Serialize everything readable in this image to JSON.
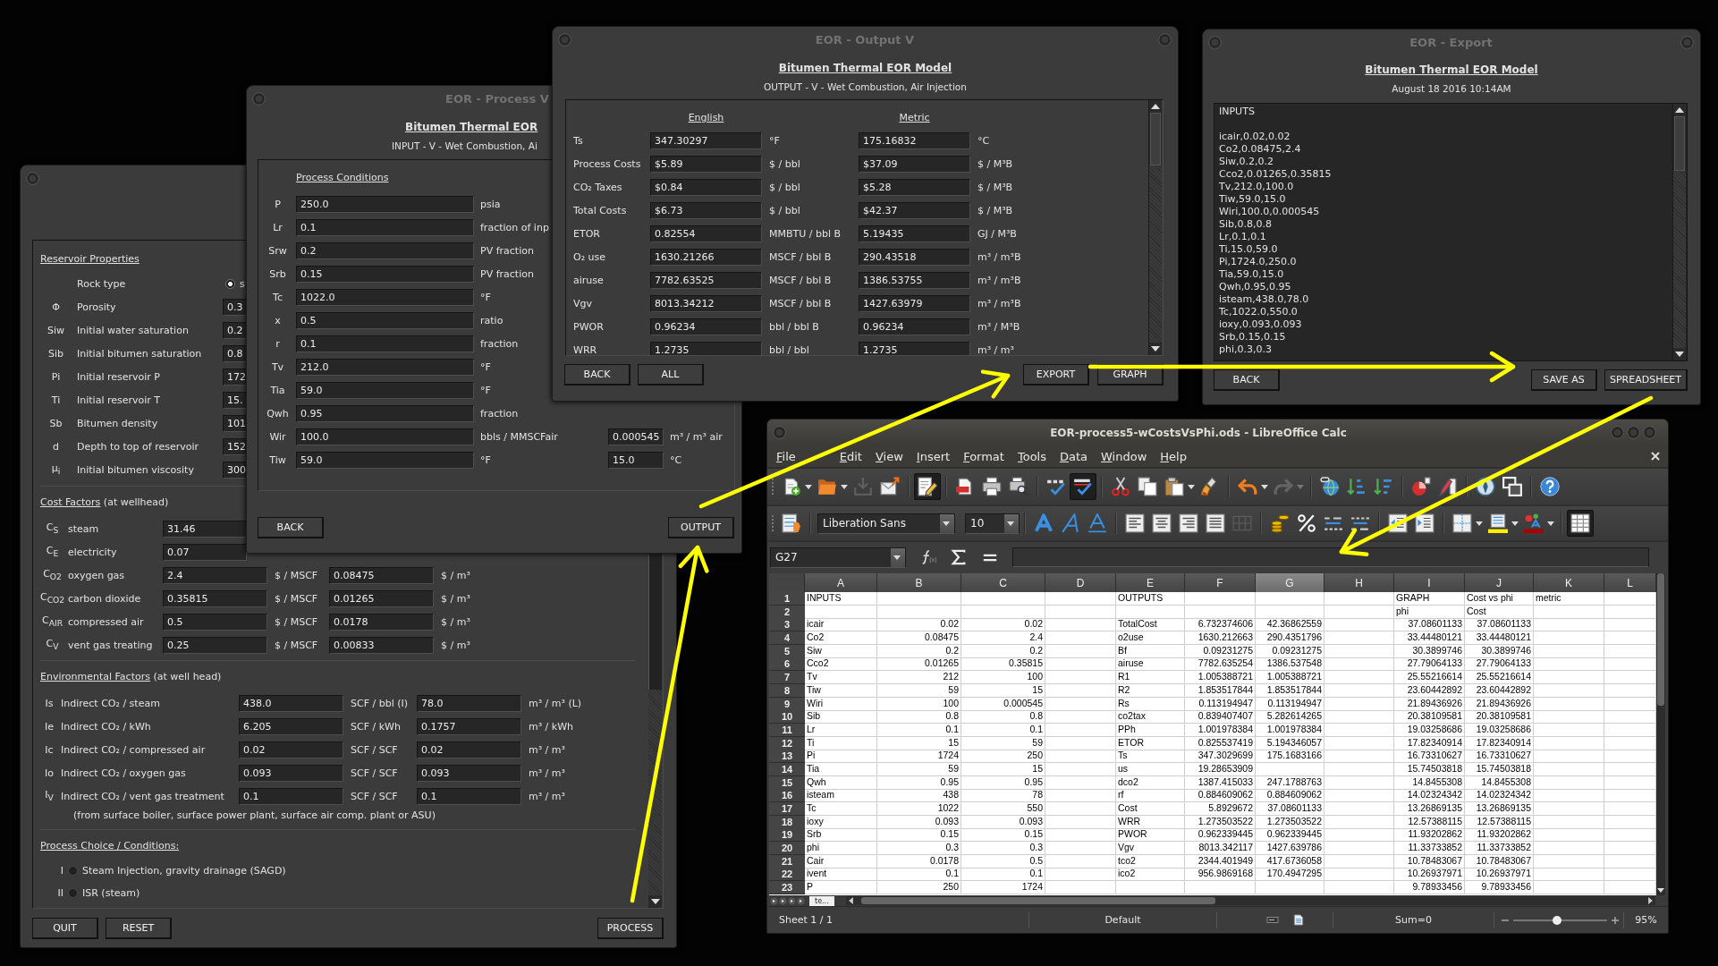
{
  "reservoir_window": {
    "reservoir_properties": {
      "title": "Reservoir Properties",
      "rock_type": {
        "label": "Rock type",
        "options": [
          {
            "label": "s",
            "selected": true
          }
        ]
      },
      "rows": [
        {
          "symbol": "Φ",
          "label": "Porosity",
          "value": "0.3"
        },
        {
          "symbol": "Siw",
          "label": "Initial water saturation",
          "value": "0.2"
        },
        {
          "symbol": "Sib",
          "label": "Initial bitumen saturation",
          "value": "0.8"
        },
        {
          "symbol": "Pi",
          "label": "Initial reservoir P",
          "value": "172"
        },
        {
          "symbol": "Ti",
          "label": "Initial reservoir T",
          "value": "15."
        },
        {
          "symbol": "Sb",
          "label": "Bitumen density",
          "value": "101"
        },
        {
          "symbol": "d",
          "label": "Depth to top of reservoir",
          "value": "152"
        },
        {
          "symbol": "μ$_{i}$",
          "label": "Initial bitumen viscosity",
          "value": "300"
        }
      ]
    },
    "cost_factors": {
      "title": "Cost Factors",
      "note": "(at wellhead)",
      "rows": [
        {
          "symbol": "C$_{S}$",
          "label": "steam",
          "value": "31.46"
        },
        {
          "symbol": "C$_{E}$",
          "label": "electricity",
          "value": "0.07"
        },
        {
          "symbol": "C$_{O2}$",
          "label": "oxygen gas",
          "value": "2.4",
          "unit": "$ / MSCF",
          "metric_value": "0.08475",
          "metric_unit": "$ / m³"
        },
        {
          "symbol": "C$_{CO2}$",
          "label": "carbon dioxide",
          "value": "0.35815",
          "unit": "$ / MSCF",
          "metric_value": "0.01265",
          "metric_unit": "$ / m³"
        },
        {
          "symbol": "C$_{AIR}$",
          "label": "compressed air",
          "value": "0.5",
          "unit": "$ / MSCF",
          "metric_value": "0.0178",
          "metric_unit": "$ / m³"
        },
        {
          "symbol": "C$_{V}$",
          "label": "vent gas treating",
          "value": "0.25",
          "unit": "$ / MSCF",
          "metric_value": "0.00833",
          "metric_unit": "$ / m³"
        }
      ]
    },
    "environmental_factors": {
      "title": "Environmental Factors",
      "note": "(at well head)",
      "rows": [
        {
          "symbol": "Is",
          "label": "Indirect CO₂ / steam",
          "value": "438.0",
          "unit": "SCF / bbl (I)",
          "metric_value": "78.0",
          "metric_unit": "m³ / m³ (L)"
        },
        {
          "symbol": "Ie",
          "label": "Indirect CO₂ / kWh",
          "value": "6.205",
          "unit": "SCF / kWh",
          "metric_value": "0.1757",
          "metric_unit": "m³ / kWh"
        },
        {
          "symbol": "Ic",
          "label": "Indirect CO₂ / compressed air",
          "value": "0.02",
          "unit": "SCF / SCF",
          "metric_value": "0.02",
          "metric_unit": "m³ / m³"
        },
        {
          "symbol": "Io",
          "label": "Indirect CO₂ / oxygen gas",
          "value": "0.093",
          "unit": "SCF / SCF",
          "metric_value": "0.093",
          "metric_unit": "m³ / m³"
        },
        {
          "symbol": "I$_{V}$",
          "label": "Indirect CO₂ / vent gas treatment",
          "value": "0.1",
          "unit": "SCF / SCF",
          "metric_value": "0.1",
          "metric_unit": "m³ / m³"
        }
      ],
      "footnote": "(from surface boiler, surface power plant, surface air comp. plant or ASU)"
    },
    "process_choice": {
      "title": "Process Choice / Conditions:",
      "options": [
        {
          "numeral": "I",
          "label": "Steam Injection, gravity drainage (SAGD)",
          "selected": false
        },
        {
          "numeral": "II",
          "label": "ISR (steam)",
          "selected": false
        }
      ]
    },
    "buttons": {
      "left": [
        "QUIT",
        "RESET"
      ],
      "right": [
        "PROCESS"
      ]
    }
  },
  "process_window": {
    "title": "EOR - Process V",
    "heading": "Bitumen Thermal EOR",
    "subtitle": "INPUT - V - Wet Combustion, Ai",
    "section": "Process Conditions",
    "rows": [
      {
        "symbol": "P",
        "value": "250.0",
        "unit": "psia"
      },
      {
        "symbol": "Lr",
        "value": "0.1",
        "unit": "fraction of inp"
      },
      {
        "symbol": "Srw",
        "value": "0.2",
        "unit": "PV fraction"
      },
      {
        "symbol": "Srb",
        "value": "0.15",
        "unit": "PV fraction"
      },
      {
        "symbol": "Tc",
        "value": "1022.0",
        "unit": "°F"
      },
      {
        "symbol": "x",
        "value": "0.5",
        "unit": "ratio"
      },
      {
        "symbol": "r",
        "value": "0.1",
        "unit": "fraction"
      },
      {
        "symbol": "Tv",
        "value": "212.0",
        "unit": "°F"
      },
      {
        "symbol": "Tia",
        "value": "59.0",
        "unit": "°F"
      },
      {
        "symbol": "Qwh",
        "value": "0.95",
        "unit": "fraction"
      },
      {
        "symbol": "Wir",
        "value": "100.0",
        "unit": "bbls / MMSCFair",
        "metric_value": "0.000545",
        "metric_unit": "m³ / m³ air"
      },
      {
        "symbol": "Tiw",
        "value": "59.0",
        "unit": "°F",
        "metric_value": "15.0",
        "metric_unit": "°C"
      }
    ],
    "buttons": {
      "left": [
        "BACK"
      ],
      "right": [
        "OUTPUT"
      ]
    }
  },
  "output_window": {
    "title": "EOR - Output V",
    "heading": "Bitumen Thermal EOR Model",
    "subtitle": "OUTPUT - V - Wet Combustion, Air Injection",
    "columns": [
      "English",
      "Metric"
    ],
    "rows": [
      {
        "label": "Ts",
        "english": "347.30297",
        "english_unit": "°F",
        "metric": "175.16832",
        "metric_unit": "°C"
      },
      {
        "label": "Process Costs",
        "english": "$5.89",
        "english_unit": "$ / bbl",
        "metric": "$37.09",
        "metric_unit": "$ / M³B"
      },
      {
        "label": "CO₂ Taxes",
        "english": "$0.84",
        "english_unit": "$ / bbl",
        "metric": "$5.28",
        "metric_unit": "$ / M³B"
      },
      {
        "label": "Total Costs",
        "english": "$6.73",
        "english_unit": "$ / bbl",
        "metric": "$42.37",
        "metric_unit": "$ / M³B"
      },
      {
        "label": "ETOR",
        "english": "0.82554",
        "english_unit": "MMBTU / bbl B",
        "metric": "5.19435",
        "metric_unit": "GJ / M³B"
      },
      {
        "label": "O₂ use",
        "english": "1630.21266",
        "english_unit": "MSCF / bbl B",
        "metric": "290.43518",
        "metric_unit": "m³ / m³B"
      },
      {
        "label": "airuse",
        "english": "7782.63525",
        "english_unit": "MSCF / bbl B",
        "metric": "1386.53755",
        "metric_unit": "m³ / m³B"
      },
      {
        "label": "Vgv",
        "english": "8013.34212",
        "english_unit": "MSCF / bbl B",
        "metric": "1427.63979",
        "metric_unit": "m³ / m³B"
      },
      {
        "label": "PWOR",
        "english": "0.96234",
        "english_unit": "bbl / bbl B",
        "metric": "0.96234",
        "metric_unit": "m³ / M³B"
      },
      {
        "label": "WRR",
        "english": "1.2735",
        "english_unit": "bbl / bbl",
        "metric": "1.2735",
        "metric_unit": "m³ / m³"
      }
    ],
    "buttons": {
      "left": [
        "BACK",
        "ALL"
      ],
      "right": [
        "EXPORT",
        "GRAPH"
      ]
    }
  },
  "export_window": {
    "title": "EOR - Export",
    "heading": "Bitumen Thermal EOR Model",
    "date": "August 18 2016 10:14AM",
    "header": "INPUTS",
    "lines": [
      "icair,0.02,0.02",
      "Co2,0.08475,2.4",
      "Siw,0.2,0.2",
      "Cco2,0.01265,0.35815",
      "Tv,212.0,100.0",
      "Tiw,59.0,15.0",
      "Wiri,100.0,0.000545",
      "Sib,0.8,0.8",
      "Lr,0.1,0.1",
      "Ti,15.0,59.0",
      "Pi,1724.0,250.0",
      "Tia,59.0,15.0",
      "Qwh,0.95,0.95",
      "isteam,438.0,78.0",
      "Tc,1022.0,550.0",
      "ioxy,0.093,0.093",
      "Srb,0.15,0.15",
      "phi,0.3,0.3"
    ],
    "buttons": {
      "left": [
        "BACK"
      ],
      "right": [
        "SAVE AS",
        "SPREADSHEET"
      ]
    }
  },
  "calc_window": {
    "title": "EOR-process5-wCostsVsPhi.ods - LibreOffice Calc",
    "menu": [
      "File",
      "Edit",
      "View",
      "Insert",
      "Format",
      "Tools",
      "Data",
      "Window",
      "Help"
    ],
    "toolbar": [
      [
        {
          "kind": "new",
          "pressed": false,
          "disabled": false
        },
        {
          "kind": "caret",
          "pressed": false,
          "disabled": false
        },
        {
          "kind": "open",
          "pressed": false,
          "disabled": false
        },
        {
          "kind": "caret",
          "pressed": false,
          "disabled": false
        },
        {
          "kind": "save",
          "pressed": false,
          "disabled": true
        },
        {
          "kind": "email",
          "pressed": false,
          "disabled": false
        }
      ],
      [
        {
          "kind": "edit",
          "pressed": true,
          "disabled": false
        }
      ],
      [
        {
          "kind": "pdf",
          "pressed": false,
          "disabled": false
        },
        {
          "kind": "print",
          "pressed": false,
          "disabled": false
        },
        {
          "kind": "preview",
          "pressed": false,
          "disabled": false
        }
      ],
      [
        {
          "kind": "spell",
          "pressed": false,
          "disabled": false
        },
        {
          "kind": "autospell",
          "pressed": true,
          "disabled": false
        }
      ],
      [
        {
          "kind": "cut",
          "pressed": false,
          "disabled": false
        },
        {
          "kind": "copy",
          "pressed": false,
          "disabled": false
        },
        {
          "kind": "paste",
          "pressed": false,
          "disabled": false
        },
        {
          "kind": "caret",
          "pressed": false,
          "disabled": false
        },
        {
          "kind": "brush",
          "pressed": false,
          "disabled": false
        }
      ],
      [
        {
          "kind": "undo",
          "pressed": false,
          "disabled": false
        },
        {
          "kind": "caret",
          "pressed": false,
          "disabled": false
        },
        {
          "kind": "redo",
          "pressed": false,
          "disabled": true
        },
        {
          "kind": "caret",
          "pressed": false,
          "disabled": true
        }
      ],
      [
        {
          "kind": "hyperlink",
          "pressed": false,
          "disabled": false
        },
        {
          "kind": "sort_asc",
          "pressed": false,
          "disabled": false
        },
        {
          "kind": "sort_desc",
          "pressed": false,
          "disabled": false
        }
      ],
      [
        {
          "kind": "chart",
          "pressed": false,
          "disabled": false
        },
        {
          "kind": "draw",
          "pressed": false,
          "disabled": false
        }
      ],
      [
        {
          "kind": "navigator",
          "pressed": false,
          "disabled": false
        },
        {
          "kind": "gallery",
          "pressed": false,
          "disabled": false
        }
      ],
      [
        {
          "kind": "help",
          "pressed": false,
          "disabled": false
        }
      ]
    ],
    "formatting_bar": {
      "lead": [
        {
          "kind": "styles",
          "pressed": false,
          "disabled": false
        }
      ],
      "font_name": "Liberation Sans",
      "font_size": "10",
      "groups": [
        [
          {
            "kind": "bold",
            "pressed": false,
            "disabled": false
          },
          {
            "kind": "italic",
            "pressed": false,
            "disabled": false
          },
          {
            "kind": "underline",
            "pressed": false,
            "disabled": false
          }
        ],
        [
          {
            "kind": "align_left",
            "pressed": false,
            "disabled": false
          },
          {
            "kind": "align_center",
            "pressed": false,
            "disabled": false
          },
          {
            "kind": "align_right",
            "pressed": false,
            "disabled": false
          },
          {
            "kind": "justify",
            "pressed": false,
            "disabled": false
          },
          {
            "kind": "merge",
            "pressed": false,
            "disabled": true
          }
        ],
        [
          {
            "kind": "currency",
            "pressed": false,
            "disabled": false
          },
          {
            "kind": "percent",
            "pressed": false,
            "disabled": false
          },
          {
            "kind": "add_decimal",
            "pressed": false,
            "disabled": false
          },
          {
            "kind": "remove_decimal",
            "pressed": false,
            "disabled": false
          }
        ],
        [
          {
            "kind": "indent_less",
            "pressed": false,
            "disabled": false
          },
          {
            "kind": "indent_more",
            "pressed": false,
            "disabled": false
          }
        ],
        [
          {
            "kind": "borders",
            "pressed": false,
            "disabled": false
          },
          {
            "kind": "caret",
            "pressed": false,
            "disabled": false
          },
          {
            "kind": "background",
            "pressed": false,
            "disabled": false
          },
          {
            "kind": "caret",
            "pressed": false,
            "disabled": false
          },
          {
            "kind": "font_color",
            "pressed": false,
            "disabled": false
          },
          {
            "kind": "caret",
            "pressed": false,
            "disabled": false
          }
        ],
        [
          {
            "kind": "grid",
            "pressed": true,
            "disabled": false
          }
        ]
      ]
    },
    "name_box": "G27",
    "columns": [
      {
        "label": "A",
        "selected": false
      },
      {
        "label": "B",
        "selected": false
      },
      {
        "label": "C",
        "selected": false
      },
      {
        "label": "D",
        "selected": false
      },
      {
        "label": "E",
        "selected": false
      },
      {
        "label": "F",
        "selected": false
      },
      {
        "label": "G",
        "selected": true
      },
      {
        "label": "H",
        "selected": false
      },
      {
        "label": "I",
        "selected": false
      },
      {
        "label": "J",
        "selected": false
      },
      {
        "label": "K",
        "selected": false
      },
      {
        "label": "L",
        "selected": false
      }
    ],
    "rows": [
      {
        "number": "1",
        "kind": "label",
        "cells": [
          "INPUTS",
          null,
          null,
          null,
          "OUTPUTS",
          null,
          null,
          null,
          "GRAPH",
          "Cost vs phi",
          "metric"
        ]
      },
      {
        "number": "2",
        "kind": "label",
        "cells": [
          null,
          null,
          null,
          null,
          null,
          null,
          null,
          null,
          "phi",
          "Cost"
        ]
      },
      {
        "number": "3",
        "kind": "data",
        "cells": [
          "icair",
          "0.02",
          "0.02",
          null,
          "TotalCost",
          "6.732374606",
          "42.36862559",
          null,
          "37.08601133",
          "37.08601133"
        ]
      },
      {
        "number": "4",
        "kind": "data",
        "cells": [
          "Co2",
          "0.08475",
          "2.4",
          null,
          "o2use",
          "1630.212663",
          "290.4351796",
          null,
          "33.44480121",
          "33.44480121"
        ]
      },
      {
        "number": "5",
        "kind": "data",
        "cells": [
          "Siw",
          "0.2",
          "0.2",
          null,
          "Bf",
          "0.09231275",
          "0.09231275",
          null,
          "30.3899746",
          "30.3899746"
        ]
      },
      {
        "number": "6",
        "kind": "data",
        "cells": [
          "Cco2",
          "0.01265",
          "0.35815",
          null,
          "airuse",
          "7782.635254",
          "1386.537548",
          null,
          "27.79064133",
          "27.79064133"
        ]
      },
      {
        "number": "7",
        "kind": "data",
        "cells": [
          "Tv",
          "212",
          "100",
          null,
          "R1",
          "1.005388721",
          "1.005388721",
          null,
          "25.55216614",
          "25.55216614"
        ]
      },
      {
        "number": "8",
        "kind": "data",
        "cells": [
          "Tiw",
          "59",
          "15",
          null,
          "R2",
          "1.853517844",
          "1.853517844",
          null,
          "23.60442892",
          "23.60442892"
        ]
      },
      {
        "number": "9",
        "kind": "data",
        "cells": [
          "Wiri",
          "100",
          "0.000545",
          null,
          "Rs",
          "0.113194947",
          "0.113194947",
          null,
          "21.89436926",
          "21.89436926"
        ]
      },
      {
        "number": "10",
        "kind": "data",
        "cells": [
          "Sib",
          "0.8",
          "0.8",
          null,
          "co2tax",
          "0.839407407",
          "5.282614265",
          null,
          "20.38109581",
          "20.38109581"
        ]
      },
      {
        "number": "11",
        "kind": "data",
        "cells": [
          "Lr",
          "0.1",
          "0.1",
          null,
          "PPh",
          "1.001978384",
          "1.001978384",
          null,
          "19.03258686",
          "19.03258686"
        ]
      },
      {
        "number": "12",
        "kind": "data",
        "cells": [
          "Ti",
          "15",
          "59",
          null,
          "ETOR",
          "0.825537419",
          "5.194346057",
          null,
          "17.82340914",
          "17.82340914"
        ]
      },
      {
        "number": "13",
        "kind": "data",
        "cells": [
          "Pi",
          "1724",
          "250",
          null,
          "Ts",
          "347.3029699",
          "175.1683166",
          null,
          "16.73310627",
          "16.73310627"
        ]
      },
      {
        "number": "14",
        "kind": "data",
        "cells": [
          "Tia",
          "59",
          "15",
          null,
          "us",
          "19.28653909",
          null,
          null,
          "15.74503818",
          "15.74503818"
        ]
      },
      {
        "number": "15",
        "kind": "data",
        "cells": [
          "Qwh",
          "0.95",
          "0.95",
          null,
          "dco2",
          "1387.415033",
          "247.1788763",
          null,
          "14.8455308",
          "14.8455308"
        ]
      },
      {
        "number": "16",
        "kind": "data",
        "cells": [
          "isteam",
          "438",
          "78",
          null,
          "rf",
          "0.884609062",
          "0.884609062",
          null,
          "14.02324342",
          "14.02324342"
        ]
      },
      {
        "number": "17",
        "kind": "data",
        "cells": [
          "Tc",
          "1022",
          "550",
          null,
          "Cost",
          "5.8929672",
          "37.08601133",
          null,
          "13.26869135",
          "13.26869135"
        ]
      },
      {
        "number": "18",
        "kind": "data",
        "cells": [
          "ioxy",
          "0.093",
          "0.093",
          null,
          "WRR",
          "1.273503522",
          "1.273503522",
          null,
          "12.57388115",
          "12.57388115"
        ]
      },
      {
        "number": "19",
        "kind": "data",
        "cells": [
          "Srb",
          "0.15",
          "0.15",
          null,
          "PWOR",
          "0.962339445",
          "0.962339445",
          null,
          "11.93202862",
          "11.93202862"
        ]
      },
      {
        "number": "20",
        "kind": "data",
        "cells": [
          "phi",
          "0.3",
          "0.3",
          null,
          "Vgv",
          "8013.342117",
          "1427.639786",
          null,
          "11.33733852",
          "11.33733852"
        ]
      },
      {
        "number": "21",
        "kind": "data",
        "cells": [
          "Cair",
          "0.0178",
          "0.5",
          null,
          "tco2",
          "2344.401949",
          "417.6736058",
          null,
          "10.78483067",
          "10.78483067"
        ]
      },
      {
        "number": "22",
        "kind": "data",
        "cells": [
          "ivent",
          "0.1",
          "0.1",
          null,
          "ico2",
          "956.9869168",
          "170.4947295",
          null,
          "10.26937971",
          "10.26937971"
        ]
      },
      {
        "number": "23",
        "kind": "data",
        "cells": [
          "P",
          "250",
          "1724",
          null,
          null,
          null,
          null,
          null,
          "9.78933456",
          "9.78933456"
        ]
      }
    ],
    "sheet_tabs": [
      {
        "label": "te...",
        "selected": true
      }
    ],
    "status": {
      "sheet": "Sheet 1 / 1",
      "page_style": "Default",
      "sum": "Sum=0",
      "zoom_slider": {
        "level": 0.47
      },
      "zoom": "95%"
    }
  }
}
